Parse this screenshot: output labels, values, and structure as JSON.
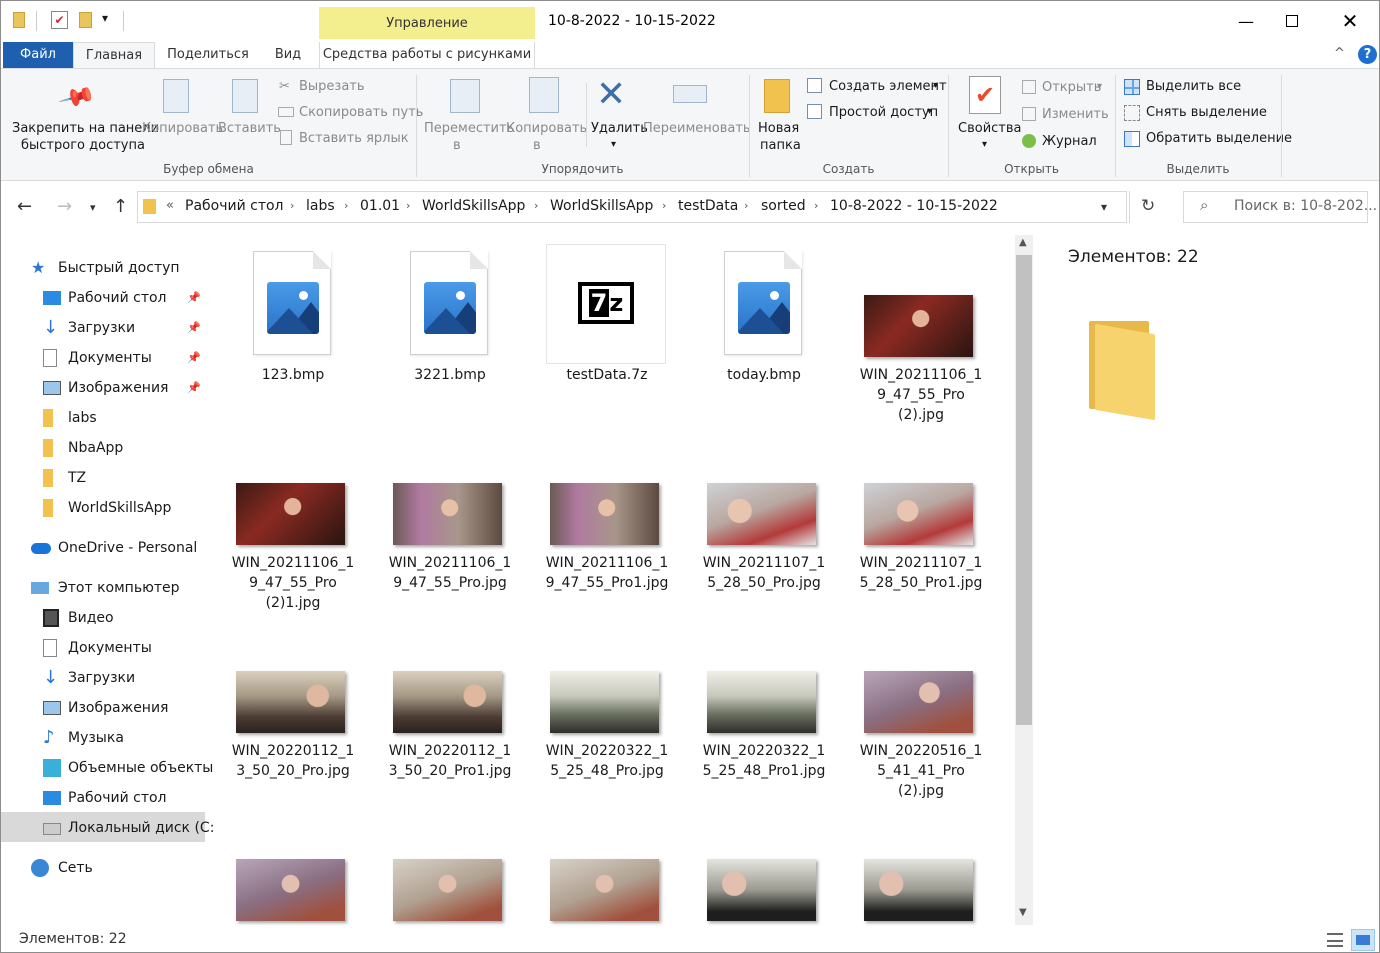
{
  "titlebar": {
    "title": "10-8-2022 - 10-15-2022",
    "context_tab": "Управление"
  },
  "tabs": {
    "file": "Файл",
    "home": "Главная",
    "share": "Поделиться",
    "view": "Вид",
    "context": "Средства работы с рисунками"
  },
  "ribbon": {
    "pin": "Закрепить на панели\nбыстрого доступа",
    "pin1": "Закрепить на панели",
    "pin2": "быстрого доступа",
    "copy": "Копировать",
    "paste": "Вставить",
    "cut": "Вырезать",
    "copy_path": "Скопировать путь",
    "paste_shortcut": "Вставить ярлык",
    "group_clipboard": "Буфер обмена",
    "move_to1": "Переместить",
    "move_to2": "в",
    "copy_to1": "Копировать",
    "copy_to2": "в",
    "delete": "Удалить",
    "rename": "Переименовать",
    "group_organize": "Упорядочить",
    "new_folder1": "Новая",
    "new_folder2": "папка",
    "new_item": "Создать элемент",
    "easy_access": "Простой доступ",
    "group_new": "Создать",
    "properties": "Свойства",
    "open": "Открыть",
    "edit": "Изменить",
    "history": "Журнал",
    "group_open": "Открыть",
    "select_all": "Выделить все",
    "select_none": "Снять выделение",
    "invert": "Обратить выделение",
    "group_select": "Выделить"
  },
  "address": {
    "crumbs": [
      "Рабочий стол",
      "labs",
      "01.01",
      "WorldSkillsApp",
      "WorldSkillsApp",
      "testData",
      "sorted",
      "10-8-2022 - 10-15-2022"
    ],
    "search_placeholder": "Поиск в: 10-8-202..."
  },
  "nav": {
    "quick": "Быстрый доступ",
    "desktop": "Рабочий стол",
    "downloads": "Загрузки",
    "documents": "Документы",
    "images": "Изображения",
    "labs": "labs",
    "nba": "NbaApp",
    "tz": "TZ",
    "wsa": "WorldSkillsApp",
    "onedrive": "OneDrive - Personal",
    "pc": "Этот компьютер",
    "video": "Видео",
    "documents2": "Документы",
    "downloads2": "Загрузки",
    "images2": "Изображения",
    "music": "Музыка",
    "objects": "Объемные объекты",
    "desktop2": "Рабочий стол",
    "disk": "Локальный диск (C:",
    "network": "Сеть"
  },
  "files": {
    "f1": "123.bmp",
    "f2": "3221.bmp",
    "f3": "testData.7z",
    "f4": "today.bmp",
    "f5a": "WIN_20211106_1",
    "f5b": "9_47_55_Pro",
    "f5c": "(2).jpg",
    "f6a": "WIN_20211106_1",
    "f6b": "9_47_55_Pro",
    "f6c": "(2)1.jpg",
    "f7a": "WIN_20211106_1",
    "f7b": "9_47_55_Pro.jpg",
    "f8a": "WIN_20211106_1",
    "f8b": "9_47_55_Pro1.jpg",
    "f9a": "WIN_20211107_1",
    "f9b": "5_28_50_Pro.jpg",
    "f10a": "WIN_20211107_1",
    "f10b": "5_28_50_Pro1.jpg",
    "f11a": "WIN_20220112_1",
    "f11b": "3_50_20_Pro.jpg",
    "f12a": "WIN_20220112_1",
    "f12b": "3_50_20_Pro1.jpg",
    "f13a": "WIN_20220322_1",
    "f13b": "5_25_48_Pro.jpg",
    "f14a": "WIN_20220322_1",
    "f14b": "5_25_48_Pro1.jpg",
    "f15a": "WIN_20220516_1",
    "f15b": "5_41_41_Pro",
    "f15c": "(2).jpg"
  },
  "details": {
    "count": "Элементов: 22"
  },
  "status": {
    "count": "Элементов: 22"
  }
}
